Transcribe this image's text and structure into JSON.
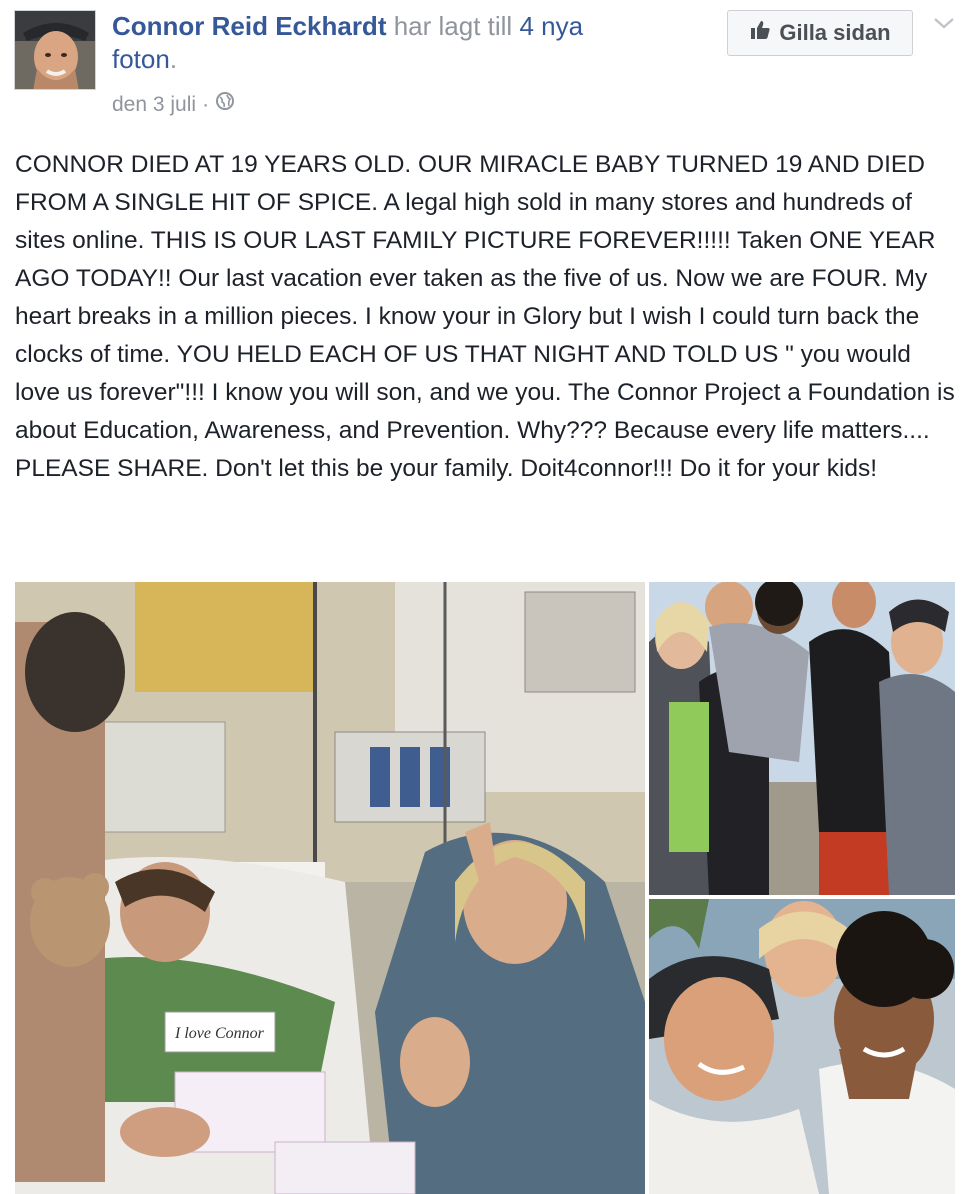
{
  "post": {
    "author": "Connor Reid Eckhardt",
    "action_text": " har lagt till ",
    "photo_count_link": "4 nya foton",
    "period": ".",
    "date": "den 3 juli",
    "separator": "·",
    "privacy_icon": "globe-icon",
    "like_page_button": "Gilla sidan",
    "like_icon": "thumbs-up-icon",
    "menu_icon": "chevron-down-icon",
    "text": "CONNOR DIED AT 19 YEARS OLD. OUR MIRACLE BABY TURNED 19 AND DIED FROM A SINGLE HIT OF SPICE. A legal high sold in many stores and hundreds of sites online. THIS IS OUR LAST FAMILY PICTURE FOREVER!!!!! Taken ONE YEAR AGO TODAY!! Our last vacation ever taken as the five of us. Now we are FOUR. My heart breaks in a million pieces. I know your in Glory but I wish I could turn back the clocks of time. YOU HELD EACH OF US THAT NIGHT AND TOLD US \" you would love us forever\"!!! I know you will son, and we you. The Connor Project a Foundation is about Education, Awareness, and Prevention. Why??? Because every life matters.... PLEASE SHARE. Don't let this be your family. Doit4connor!!! Do it for your kids!"
  },
  "photos": {
    "note_card_text": "I love Connor"
  },
  "colors": {
    "link": "#365899",
    "meta": "#90949c",
    "text": "#1d2129"
  }
}
